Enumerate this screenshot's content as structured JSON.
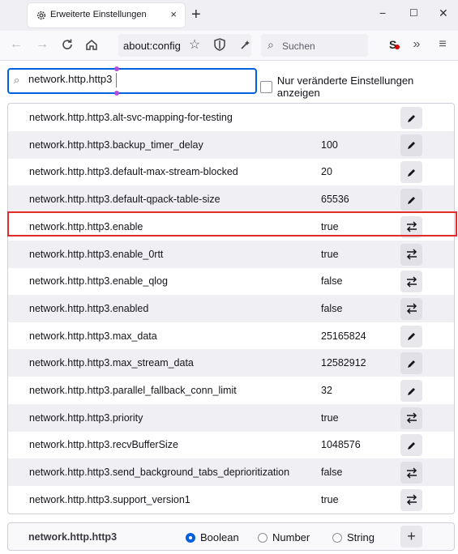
{
  "tab": {
    "title": "Erweiterte Einstellungen",
    "close": "×"
  },
  "window": {
    "minimize": "−",
    "maximize": "☐",
    "close": "✕",
    "new_tab": "+"
  },
  "nav": {
    "url": "about:config",
    "search_placeholder": "Suchen",
    "overflow": "»",
    "menu": "≡"
  },
  "config": {
    "search_value": "network.http.http3",
    "modified_only_label": "Nur veränderte Einstellungen anzeigen"
  },
  "prefs": [
    {
      "name": "network.http.http3.alt-svc-mapping-for-testing",
      "value": "",
      "action": "edit"
    },
    {
      "name": "network.http.http3.backup_timer_delay",
      "value": "100",
      "action": "edit"
    },
    {
      "name": "network.http.http3.default-max-stream-blocked",
      "value": "20",
      "action": "edit"
    },
    {
      "name": "network.http.http3.default-qpack-table-size",
      "value": "65536",
      "action": "edit"
    },
    {
      "name": "network.http.http3.enable",
      "value": "true",
      "action": "toggle"
    },
    {
      "name": "network.http.http3.enable_0rtt",
      "value": "true",
      "action": "toggle"
    },
    {
      "name": "network.http.http3.enable_qlog",
      "value": "false",
      "action": "toggle"
    },
    {
      "name": "network.http.http3.enabled",
      "value": "false",
      "action": "toggle"
    },
    {
      "name": "network.http.http3.max_data",
      "value": "25165824",
      "action": "edit"
    },
    {
      "name": "network.http.http3.max_stream_data",
      "value": "12582912",
      "action": "edit"
    },
    {
      "name": "network.http.http3.parallel_fallback_conn_limit",
      "value": "32",
      "action": "edit"
    },
    {
      "name": "network.http.http3.priority",
      "value": "true",
      "action": "toggle"
    },
    {
      "name": "network.http.http3.recvBufferSize",
      "value": "1048576",
      "action": "edit"
    },
    {
      "name": "network.http.http3.send_background_tabs_deprioritization",
      "value": "false",
      "action": "toggle"
    },
    {
      "name": "network.http.http3.support_version1",
      "value": "true",
      "action": "toggle"
    }
  ],
  "add": {
    "name": "network.http.http3",
    "types": [
      "Boolean",
      "Number",
      "String"
    ],
    "selected": "Boolean",
    "button": "+"
  }
}
